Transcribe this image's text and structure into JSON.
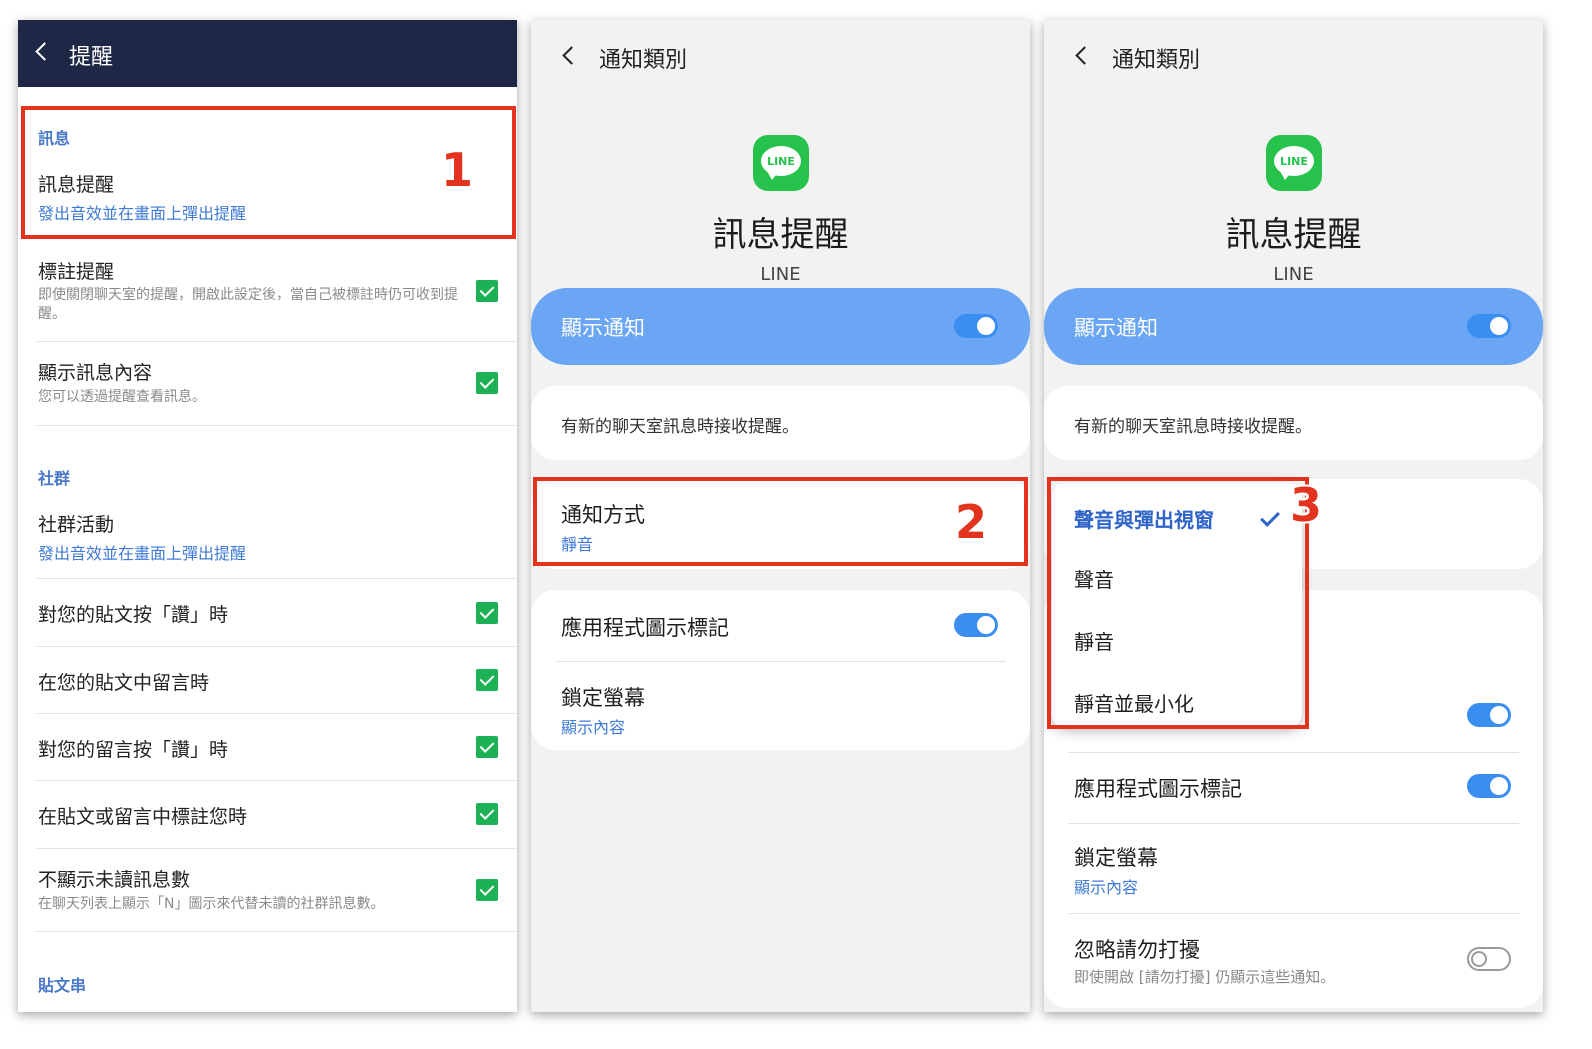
{
  "panel1": {
    "header_title": "提醒",
    "sections": {
      "messages": "訊息",
      "community": "社群",
      "posts": "貼文串"
    },
    "items": [
      {
        "title": "訊息提醒",
        "subtitle": "發出音效並在畫面上彈出提醒"
      },
      {
        "title": "標註提醒",
        "desc": "即使關閉聊天室的提醒，開啟此設定後，當自己被標註時仍可收到提醒。"
      },
      {
        "title": "顯示訊息內容",
        "desc": "您可以透過提醒查看訊息。"
      },
      {
        "title": "社群活動",
        "subtitle": "發出音效並在畫面上彈出提醒"
      },
      {
        "title": "對您的貼文按「讚」時"
      },
      {
        "title": "在您的貼文中留言時"
      },
      {
        "title": "對您的留言按「讚」時"
      },
      {
        "title": "在貼文或留言中標註您時"
      },
      {
        "title": "不顯示未讀訊息數",
        "desc": "在聊天列表上顯示「N」圖示來代替未讀的社群訊息數。"
      }
    ]
  },
  "panel2": {
    "nav_title": "通知類別",
    "logo_text": "LINE",
    "big_title": "訊息提醒",
    "app_name": "LINE",
    "show_notification": "顯示通知",
    "description": "有新的聊天室訊息時接收提醒。",
    "notify_method": {
      "title": "通知方式",
      "value": "靜音"
    },
    "app_badge": "應用程式圖示標記",
    "lock_screen": {
      "title": "鎖定螢幕",
      "value": "顯示內容"
    }
  },
  "panel3": {
    "nav_title": "通知類別",
    "logo_text": "LINE",
    "big_title": "訊息提醒",
    "app_name": "LINE",
    "show_notification": "顯示通知",
    "description": "有新的聊天室訊息時接收提醒。",
    "dropdown_options": [
      "聲音與彈出視窗",
      "聲音",
      "靜音",
      "靜音並最小化"
    ],
    "app_badge": "應用程式圖示標記",
    "lock_screen": {
      "title": "鎖定螢幕",
      "value": "顯示內容"
    },
    "dnd": {
      "title": "忽略請勿打擾",
      "desc": "即使開啟 [請勿打擾] 仍顯示這些通知。"
    }
  },
  "annotations": {
    "step1": "1",
    "step2": "2",
    "step3": "3"
  },
  "colors": {
    "header_navy": "#1e2746",
    "accent_blue": "#3f7ad6",
    "bar_blue": "#6ba6f5",
    "toggle_blue": "#3a8ef0",
    "check_green": "#1db155",
    "line_green": "#27c24c",
    "annotation_red": "#e3321e"
  }
}
